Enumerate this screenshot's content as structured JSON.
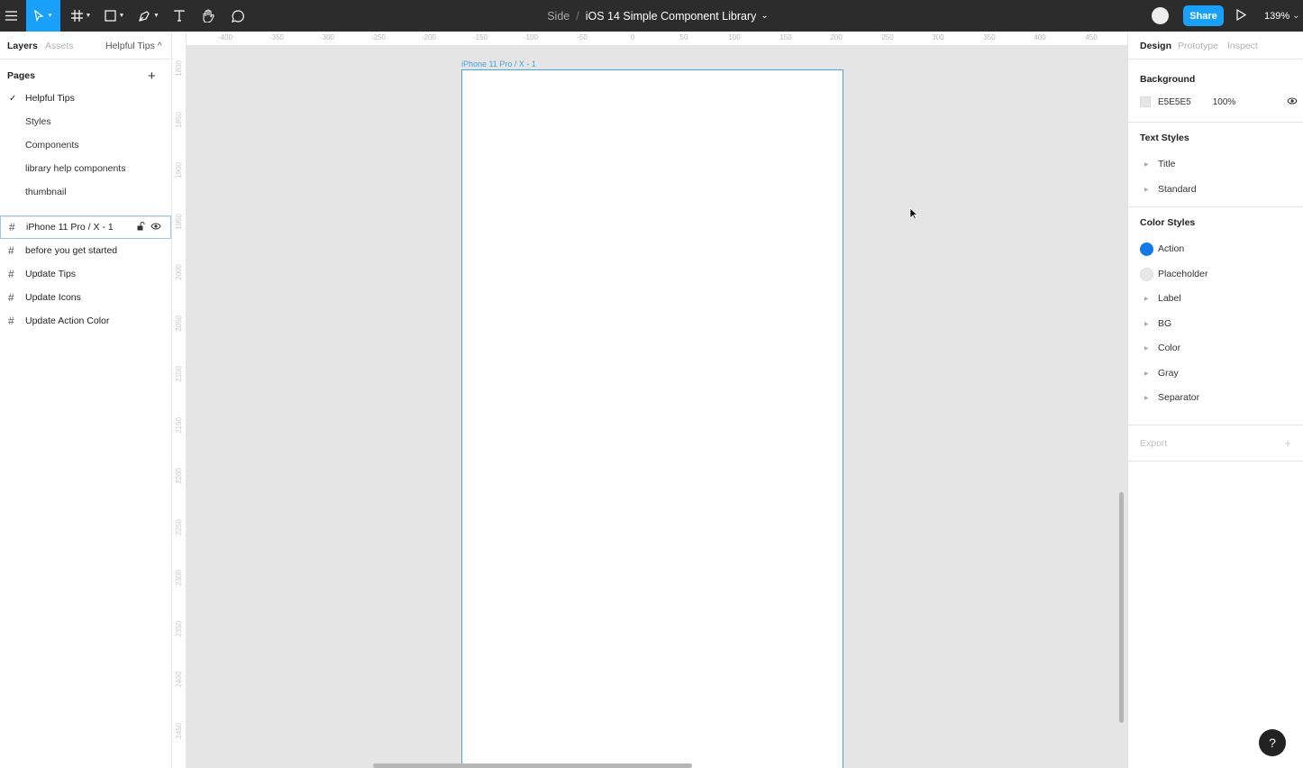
{
  "toolbar": {
    "project": "Side",
    "separator": "/",
    "file_name": "iOS 14 Simple Component Library",
    "file_caret": "⌄",
    "share_label": "Share",
    "zoom": "139%",
    "zoom_caret": "⌄",
    "accent": "#18a0fb"
  },
  "left_panel": {
    "tabs": {
      "layers": "Layers",
      "assets": "Assets",
      "page": "Helpful Tips ^"
    },
    "pages_heading": "Pages",
    "add_label": "+",
    "current_check": "✓",
    "pages": [
      "Helpful Tips",
      "Styles",
      "Components",
      "library help components",
      "thumbnail"
    ],
    "layers": [
      "iPhone 11 Pro / X - 1",
      "before you get started",
      "Update Tips",
      "Update Icons",
      "Update Action Color"
    ]
  },
  "rulers": {
    "top": [
      "-400",
      "-350",
      "-300",
      "-250",
      "-200",
      "-150",
      "-100",
      "-50",
      "0",
      "50",
      "100",
      "150",
      "200",
      "250",
      "300",
      "350",
      "400",
      "450"
    ],
    "left": [
      "1800",
      "1850",
      "1900",
      "1950",
      "2000",
      "2050",
      "2100",
      "2150",
      "2200",
      "2250",
      "2300",
      "2350",
      "2400",
      "2450"
    ]
  },
  "canvas": {
    "frame_label": "iPhone 11 Pro / X - 1",
    "background": "#e5e5e5"
  },
  "right_panel": {
    "tabs": {
      "design": "Design",
      "prototype": "Prototype",
      "inspect": "Inspect"
    },
    "background_heading": "Background",
    "background_hex": "E5E5E5",
    "background_opacity": "100%",
    "text_styles_heading": "Text Styles",
    "text_styles": [
      "Title",
      "Standard"
    ],
    "color_styles_heading": "Color Styles",
    "color_styles": [
      {
        "name": "Action",
        "color": "#1479e6"
      },
      {
        "name": "Placeholder",
        "color": "#e8e8e8"
      }
    ],
    "color_groups": [
      "Label",
      "BG",
      "Color",
      "Gray",
      "Separator"
    ],
    "export_label": "Export",
    "export_add": "+",
    "help_label": "?"
  }
}
